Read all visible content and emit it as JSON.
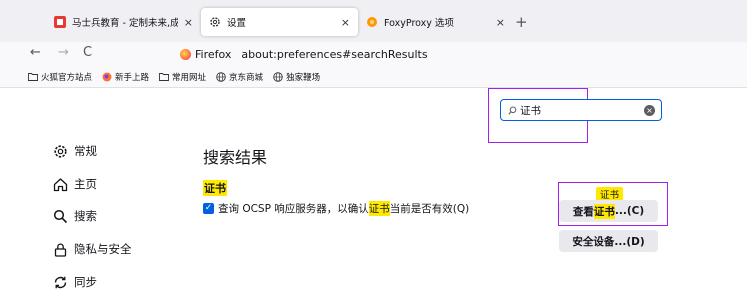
{
  "tabs": [
    {
      "title": "马士兵教育 - 定制未来,成就更好",
      "close": "×"
    },
    {
      "title": "设置",
      "close": "×"
    },
    {
      "title": "FoxyProxy 选项",
      "close": "×"
    }
  ],
  "new_tab": "+",
  "nav": {
    "back": "←",
    "forward": "→",
    "reload": "C"
  },
  "urlbar": {
    "identity": "Firefox",
    "address": "about:preferences#searchResults"
  },
  "bookmarks": [
    {
      "label": "火狐官方站点",
      "icon": "folder-icon"
    },
    {
      "label": "新手上路",
      "icon": "firefox-icon"
    },
    {
      "label": "常用网址",
      "icon": "folder-icon"
    },
    {
      "label": "京东商城",
      "icon": "globe-icon"
    },
    {
      "label": "独家鞭场",
      "icon": "globe-icon"
    }
  ],
  "search": {
    "value": "证书",
    "clear": "×"
  },
  "sidebar": [
    {
      "label": "常规",
      "icon": "gear-icon"
    },
    {
      "label": "主页",
      "icon": "home-icon"
    },
    {
      "label": "搜索",
      "icon": "search-icon"
    },
    {
      "label": "隐私与安全",
      "icon": "lock-icon"
    },
    {
      "label": "同步",
      "icon": "sync-icon"
    }
  ],
  "results": {
    "title": "搜索结果",
    "group": "证书",
    "checkbox": {
      "before": "查询 OCSP 响应服务器，以确认",
      "highlight": "证书",
      "after": "当前是否有效(Q)",
      "checked": true
    },
    "tooltip": "证书",
    "view_cert": {
      "pre": "查看",
      "hl": "证书",
      "post": "...(C)"
    },
    "security_devices": "安全设备...(D)"
  },
  "colors": {
    "highlight": "#ffe900",
    "annotation": "#a020f0",
    "accent": "#0061e0"
  }
}
